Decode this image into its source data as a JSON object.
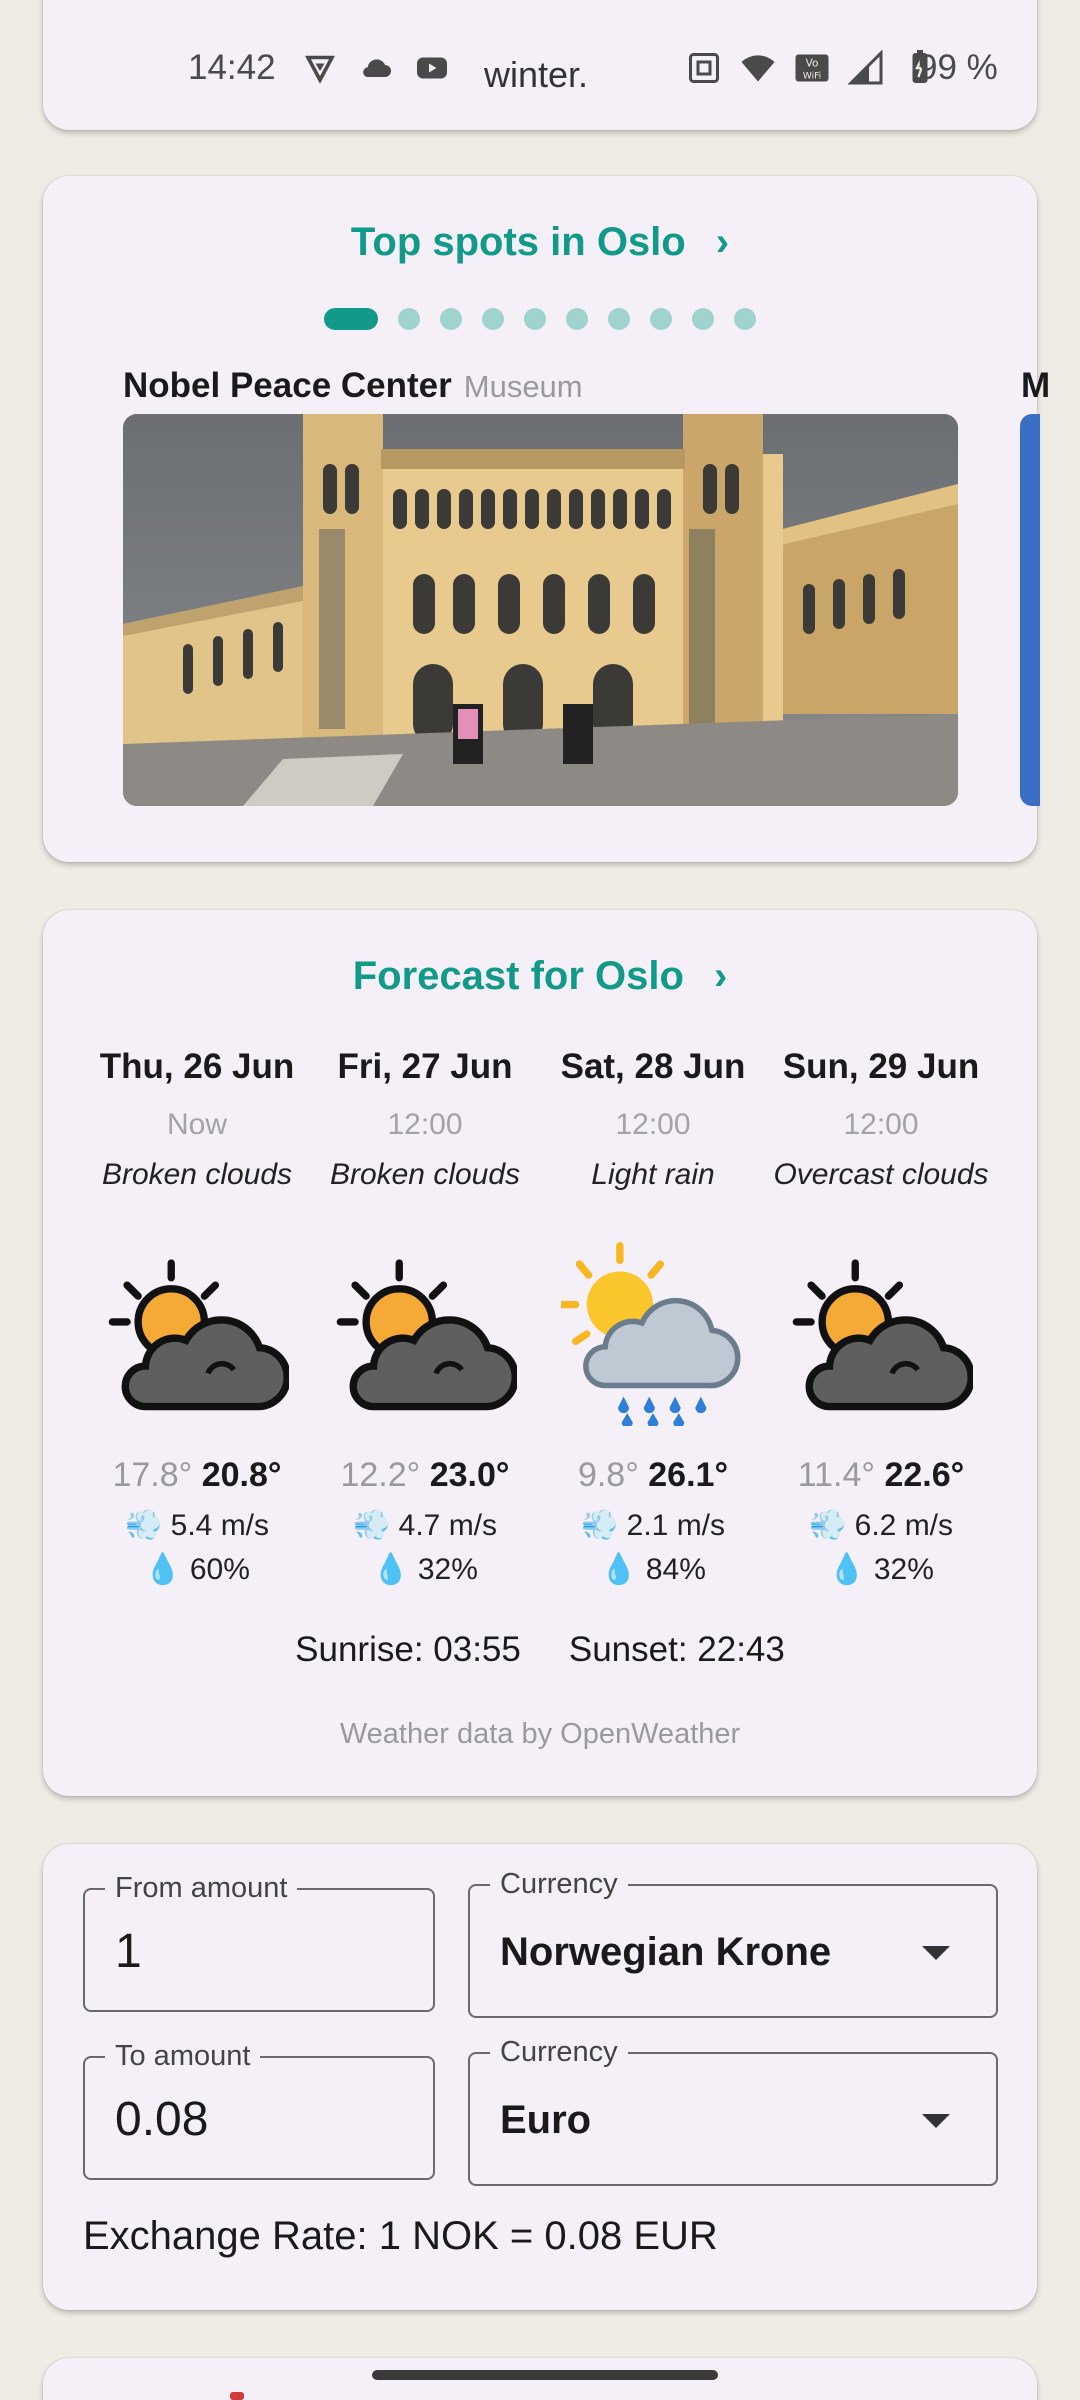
{
  "status_bar": {
    "time": "14:42",
    "notification_text": "winter.",
    "battery_text": "99 %",
    "icons_left": [
      "vpn-icon",
      "cloud-icon",
      "youtube-icon"
    ],
    "icons_right": [
      "nfc-icon",
      "wifi-icon",
      "vowifi-icon",
      "signal-icon",
      "battery-icon"
    ]
  },
  "spots": {
    "title": "Top spots in Oslo",
    "chevron": "›",
    "page_count": 10,
    "active_page": 0,
    "items": [
      {
        "name": "Nobel Peace Center",
        "type": "Museum"
      }
    ],
    "peek_label": "M"
  },
  "forecast": {
    "title": "Forecast for Oslo",
    "chevron": "›",
    "days": [
      {
        "date": "Thu, 26 Jun",
        "time": "Now",
        "condition": "Broken clouds",
        "icon": "sun-behind-dark-cloud-icon",
        "min": "17.8°",
        "max": "20.8°",
        "wind": "5.4 m/s",
        "rain": "60%"
      },
      {
        "date": "Fri, 27 Jun",
        "time": "12:00",
        "condition": "Broken clouds",
        "icon": "sun-behind-dark-cloud-icon",
        "min": "12.2°",
        "max": "23.0°",
        "wind": "4.7 m/s",
        "rain": "32%"
      },
      {
        "date": "Sat, 28 Jun",
        "time": "12:00",
        "condition": "Light rain",
        "icon": "sun-rain-cloud-icon",
        "min": "9.8°",
        "max": "26.1°",
        "wind": "2.1 m/s",
        "rain": "84%"
      },
      {
        "date": "Sun, 29 Jun",
        "time": "12:00",
        "condition": "Overcast clouds",
        "icon": "sun-behind-dark-cloud-icon",
        "min": "11.4°",
        "max": "22.6°",
        "wind": "6.2 m/s",
        "rain": "32%"
      }
    ],
    "sunrise": "Sunrise: 03:55",
    "sunset": "Sunset: 22:43",
    "credit": "Weather data by OpenWeather"
  },
  "currency": {
    "from_label": "From amount",
    "from_value": "1",
    "from_currency_label": "Currency",
    "from_currency": "Norwegian Krone",
    "to_label": "To amount",
    "to_value": "0.08",
    "to_currency_label": "Currency",
    "to_currency": "Euro",
    "rate_text": "Exchange Rate: 1 NOK = 0.08 EUR"
  },
  "colors": {
    "accent": "#11998a",
    "card_bg": "#f5f0f8",
    "page_bg": "#efece5"
  }
}
